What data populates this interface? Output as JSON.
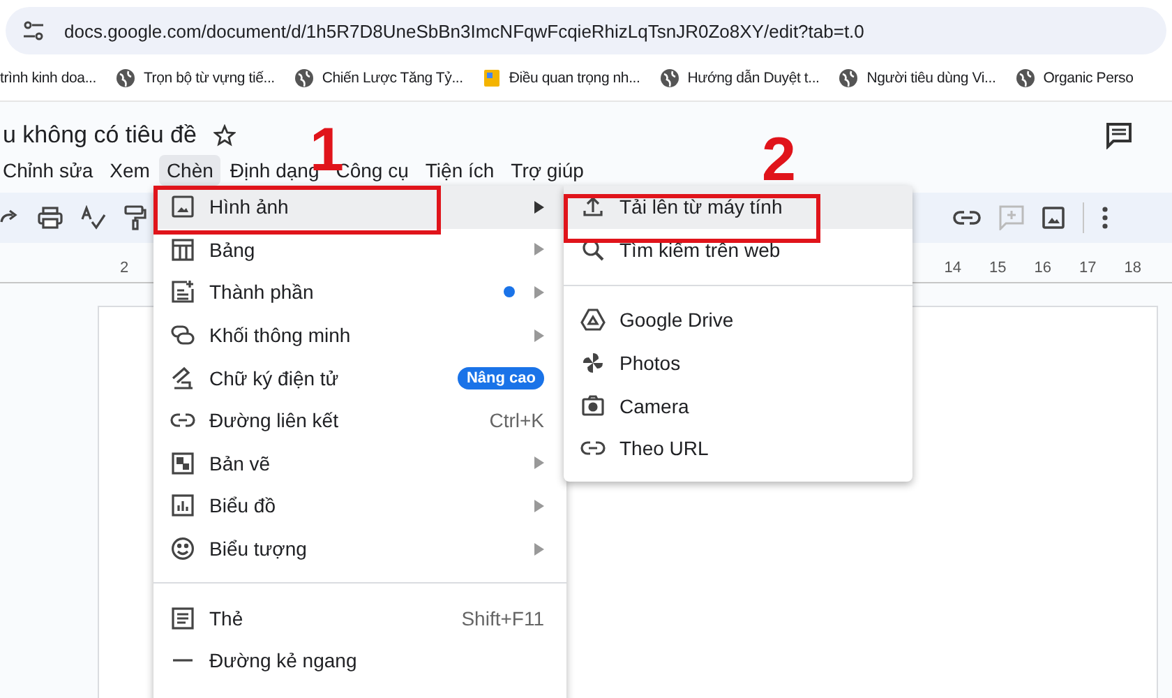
{
  "address_bar": {
    "url": "docs.google.com/document/d/1h5R7D8UneSbBn3ImcNFqwFcqieRhizLqTsnJR0Zo8XY/edit?tab=t.0"
  },
  "bookmarks": [
    "trình kinh doa...",
    "Trọn bộ từ vựng tiế...",
    "Chiến Lược Tăng Tỷ...",
    "Điều quan trọng nh...",
    "Hướng dẫn Duyệt t...",
    "Người tiêu dùng Vi...",
    "Organic Perso"
  ],
  "document": {
    "title": "u không có tiêu đề"
  },
  "menubar": [
    {
      "label": "Chỉnh sửa",
      "selected": false
    },
    {
      "label": "Xem",
      "selected": false
    },
    {
      "label": "Chèn",
      "selected": true
    },
    {
      "label": "Định dạng",
      "selected": false
    },
    {
      "label": "Công cụ",
      "selected": false
    },
    {
      "label": "Tiện ích",
      "selected": false
    },
    {
      "label": "Trợ giúp",
      "selected": false
    }
  ],
  "ruler": [
    "2",
    "14",
    "15",
    "16",
    "17",
    "18"
  ],
  "insert_menu": [
    {
      "label": "Hình ảnh",
      "kind": "submenu",
      "selected": true
    },
    {
      "label": "Bảng",
      "kind": "submenu",
      "selected": false
    },
    {
      "label": "Thành phần",
      "kind": "submenu",
      "selected": false,
      "new_dot": true
    },
    {
      "label": "Khối thông minh",
      "kind": "submenu",
      "selected": false
    },
    {
      "label": "Chữ ký điện tử",
      "kind": "badge",
      "selected": false,
      "badge": "Nâng cao"
    },
    {
      "label": "Đường liên kết",
      "kind": "shortcut",
      "selected": false,
      "shortcut": "Ctrl+K"
    },
    {
      "label": "Bản vẽ",
      "kind": "submenu",
      "selected": false
    },
    {
      "label": "Biểu đồ",
      "kind": "submenu",
      "selected": false
    },
    {
      "label": "Biểu tượng",
      "kind": "submenu",
      "selected": false
    },
    {
      "kind": "divider"
    },
    {
      "label": "Thẻ",
      "kind": "shortcut",
      "selected": false,
      "shortcut": "Shift+F11"
    },
    {
      "label": "Đường kẻ ngang",
      "kind": "plain",
      "selected": false
    }
  ],
  "image_submenu": [
    {
      "label": "Tải lên từ máy tính",
      "kind": "item",
      "selected": true
    },
    {
      "label": "Tìm kiếm trên web",
      "kind": "item",
      "selected": false
    },
    {
      "kind": "divider"
    },
    {
      "label": "Google Drive",
      "kind": "item",
      "selected": false
    },
    {
      "label": "Photos",
      "kind": "item",
      "selected": false
    },
    {
      "label": "Camera",
      "kind": "item",
      "selected": false
    },
    {
      "label": "Theo URL",
      "kind": "item",
      "selected": false
    }
  ],
  "annotations": [
    {
      "label": "1"
    },
    {
      "label": "2"
    }
  ]
}
